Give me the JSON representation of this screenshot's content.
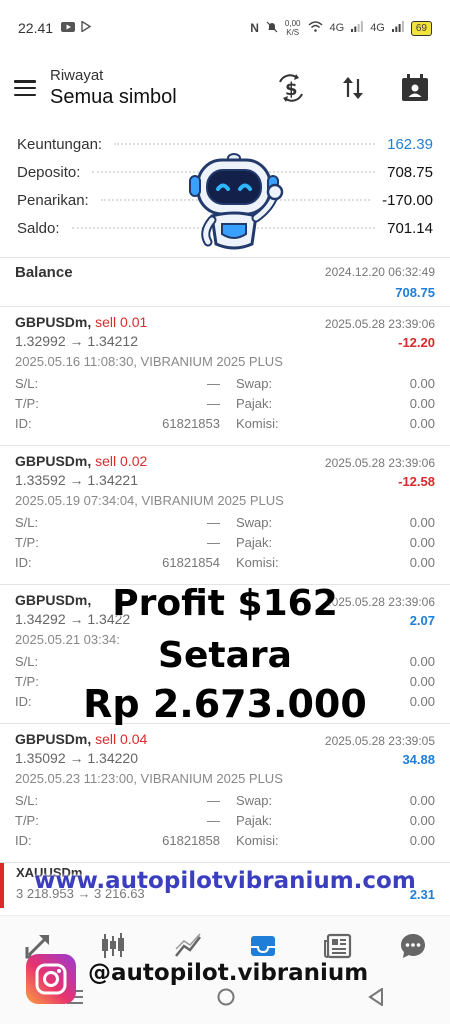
{
  "status": {
    "time": "22.41",
    "icons": [
      "youtube-icon",
      "play-store-icon",
      "nfc-icon",
      "mute-icon",
      "wifi-icon",
      "signal-icon"
    ],
    "speed": "0,00",
    "speed_unit": "K/S",
    "net1": "4G",
    "net2": "4G",
    "battery": "69"
  },
  "header": {
    "subtitle": "Riwayat",
    "title": "Semua simbol",
    "actions": [
      "currency-exchange-icon",
      "sort-icon",
      "calendar-icon"
    ]
  },
  "summary": [
    {
      "label": "Keuntungan:",
      "value": "162.39",
      "color": "#1e7ed8"
    },
    {
      "label": "Deposito:",
      "value": "708.75"
    },
    {
      "label": "Penarikan:",
      "value": "-170.00"
    },
    {
      "label": "Saldo:",
      "value": "701.14"
    }
  ],
  "balance": {
    "name": "Balance",
    "date": "2024.12.20 06:32:49",
    "amount": "708.75"
  },
  "trades": [
    {
      "symbol": "GBPUSDm,",
      "side": "sell 0.01",
      "close_time": "2025.05.28 23:39:06",
      "prices": "1.32992 → 1.34212",
      "profit": "-12.20",
      "profit_color": "red",
      "opened": "2025.05.16 11:08:30, VIBRANIUM 2025 PLUS",
      "sl_label": "S/L:",
      "sl": "—",
      "swap_label": "Swap:",
      "swap": "0.00",
      "tp_label": "T/P:",
      "tp": "—",
      "tax_label": "Pajak:",
      "tax": "0.00",
      "id_label": "ID:",
      "id": "61821853",
      "comm_label": "Komisi:",
      "comm": "0.00"
    },
    {
      "symbol": "GBPUSDm,",
      "side": "sell 0.02",
      "close_time": "2025.05.28 23:39:06",
      "prices": "1.33592 → 1.34221",
      "profit": "-12.58",
      "profit_color": "red",
      "opened": "2025.05.19 07:34:04, VIBRANIUM 2025 PLUS",
      "sl_label": "S/L:",
      "sl": "—",
      "swap_label": "Swap:",
      "swap": "0.00",
      "tp_label": "T/P:",
      "tp": "—",
      "tax_label": "Pajak:",
      "tax": "0.00",
      "id_label": "ID:",
      "id": "61821854",
      "comm_label": "Komisi:",
      "comm": "0.00"
    },
    {
      "symbol": "GBPUSDm,",
      "side": "",
      "close_time": "2025.05.28 23:39:06",
      "prices": "1.34292 → 1.3422",
      "profit": "2.07",
      "profit_color": "blue",
      "opened": "2025.05.21 03:34:",
      "sl_label": "S/L:",
      "sl": "",
      "swap_label": "",
      "swap": "0.00",
      "tp_label": "T/P:",
      "tp": "",
      "tax_label": "",
      "tax": "0.00",
      "id_label": "ID:",
      "id": "",
      "comm_label": "",
      "comm": "0.00"
    },
    {
      "symbol": "GBPUSDm,",
      "side": "sell 0.04",
      "close_time": "2025.05.28 23:39:05",
      "prices": "1.35092 → 1.34220",
      "profit": "34.88",
      "profit_color": "blue",
      "opened": "2025.05.23 11:23:00, VIBRANIUM 2025 PLUS",
      "sl_label": "S/L:",
      "sl": "—",
      "swap_label": "Swap:",
      "swap": "0.00",
      "tp_label": "T/P:",
      "tp": "—",
      "tax_label": "Pajak:",
      "tax": "0.00",
      "id_label": "ID:",
      "id": "61821858",
      "comm_label": "Komisi:",
      "comm": "0.00"
    }
  ],
  "partial_row": {
    "symbol": "XAUUSDm",
    "prices": "3 218.953 → 3 216.63",
    "profit": "2.31"
  },
  "overlay": {
    "line1": "Profit $162",
    "line2": "Setara",
    "line3": "Rp 2.673.000"
  },
  "promo": {
    "url": "www.autopilotvibranium.com",
    "instagram": "@autopilot.vibranium"
  },
  "bottom_nav": [
    "trade-icon",
    "chart-candles-icon",
    "chart-line-icon",
    "history-inbox-icon",
    "news-icon",
    "chat-icon"
  ],
  "colors": {
    "accent": "#1e7ed8",
    "loss": "#d92b2b",
    "url": "#3b3fbf"
  }
}
